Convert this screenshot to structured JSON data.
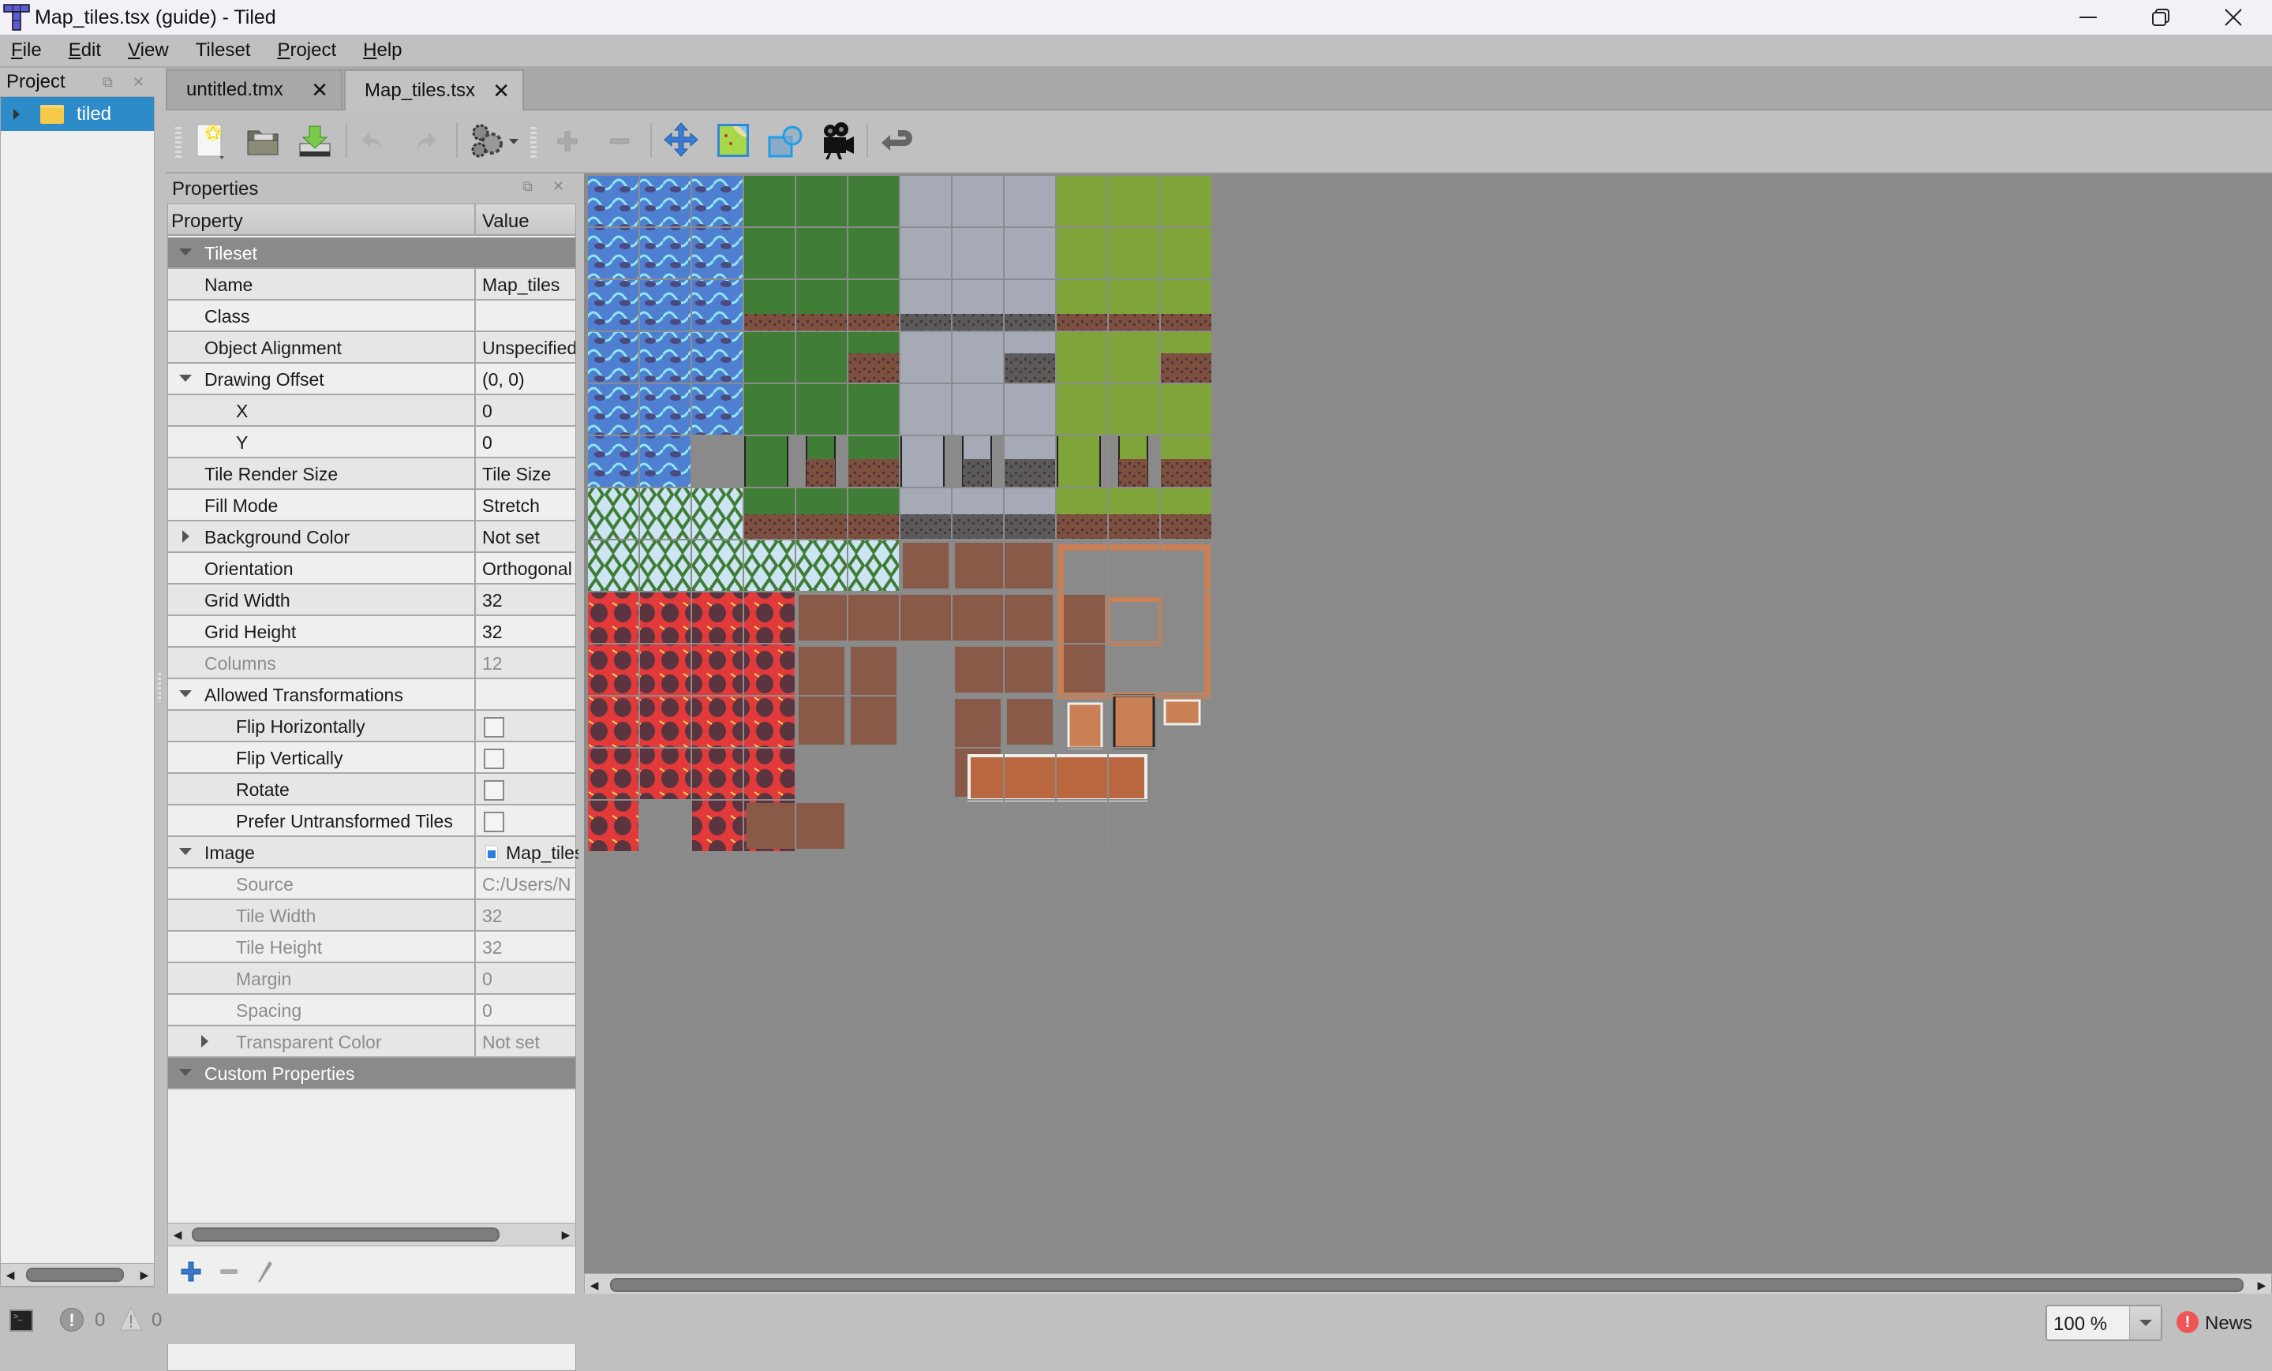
{
  "window": {
    "title": "Map_tiles.tsx (guide) - Tiled",
    "controls": [
      "minimize",
      "restore",
      "close"
    ]
  },
  "menu": [
    {
      "label": "File",
      "mnemonic": "F"
    },
    {
      "label": "Edit",
      "mnemonic": "E"
    },
    {
      "label": "View",
      "mnemonic": "V"
    },
    {
      "label": "Tileset",
      "mnemonic": ""
    },
    {
      "label": "Project",
      "mnemonic": "P"
    },
    {
      "label": "Help",
      "mnemonic": "H"
    }
  ],
  "project_panel": {
    "title": "Project",
    "tree": [
      {
        "label": "tiled",
        "icon": "folder-icon",
        "selected": true,
        "expanded": false
      }
    ]
  },
  "tabs": [
    {
      "label": "untitled.tmx",
      "active": false
    },
    {
      "label": "Map_tiles.tsx",
      "active": true
    }
  ],
  "toolbar": [
    {
      "name": "new-file",
      "enabled": true
    },
    {
      "name": "open-file",
      "enabled": true
    },
    {
      "name": "save-file",
      "enabled": true
    },
    {
      "name": "undo",
      "enabled": false
    },
    {
      "name": "redo",
      "enabled": false
    },
    {
      "name": "tileset-properties",
      "enabled": true
    },
    {
      "name": "add-tiles",
      "enabled": false
    },
    {
      "name": "remove-tiles",
      "enabled": false
    },
    {
      "name": "dynamic-wrapping",
      "enabled": true
    },
    {
      "name": "edit-terrain",
      "enabled": true
    },
    {
      "name": "edit-collision",
      "enabled": true
    },
    {
      "name": "edit-animation",
      "enabled": true
    },
    {
      "name": "back",
      "enabled": true
    }
  ],
  "properties": {
    "title": "Properties",
    "columns": [
      "Property",
      "Value"
    ],
    "rows": [
      {
        "key": "Tileset",
        "type": "group",
        "expanded": true
      },
      {
        "key": "Name",
        "value": "Map_tiles",
        "indent": 1
      },
      {
        "key": "Class",
        "value": "",
        "indent": 1
      },
      {
        "key": "Object Alignment",
        "value": "Unspecified",
        "indent": 1
      },
      {
        "key": "Drawing Offset",
        "value": "(0, 0)",
        "indent": 1,
        "expander": "down"
      },
      {
        "key": "X",
        "value": "0",
        "indent": 2
      },
      {
        "key": "Y",
        "value": "0",
        "indent": 2
      },
      {
        "key": "Tile Render Size",
        "value": "Tile Size",
        "indent": 1
      },
      {
        "key": "Fill Mode",
        "value": "Stretch",
        "indent": 1
      },
      {
        "key": "Background Color",
        "value": "Not set",
        "indent": 1,
        "expander": "right"
      },
      {
        "key": "Orientation",
        "value": "Orthogonal",
        "indent": 1
      },
      {
        "key": "Grid Width",
        "value": "32",
        "indent": 1
      },
      {
        "key": "Grid Height",
        "value": "32",
        "indent": 1
      },
      {
        "key": "Columns",
        "value": "12",
        "indent": 1,
        "disabled": true
      },
      {
        "key": "Allowed Transformations",
        "value": "",
        "indent": 1,
        "expander": "down"
      },
      {
        "key": "Flip Horizontally",
        "checkbox": false,
        "indent": 2
      },
      {
        "key": "Flip Vertically",
        "checkbox": false,
        "indent": 2
      },
      {
        "key": "Rotate",
        "checkbox": false,
        "indent": 2
      },
      {
        "key": "Prefer Untransformed Tiles",
        "checkbox": false,
        "indent": 2
      },
      {
        "key": "Image",
        "value": "Map_tiles",
        "indent": 1,
        "expander": "down",
        "icon": "image-file-icon"
      },
      {
        "key": "Source",
        "value": "C:/Users/N",
        "indent": 2,
        "disabled": true
      },
      {
        "key": "Tile Width",
        "value": "32",
        "indent": 2,
        "disabled": true
      },
      {
        "key": "Tile Height",
        "value": "32",
        "indent": 2,
        "disabled": true
      },
      {
        "key": "Margin",
        "value": "0",
        "indent": 2,
        "disabled": true
      },
      {
        "key": "Spacing",
        "value": "0",
        "indent": 2,
        "disabled": true
      },
      {
        "key": "Transparent Color",
        "value": "Not set",
        "indent": 2,
        "disabled": true,
        "expander": "right"
      },
      {
        "key": "Custom Properties",
        "type": "group",
        "expanded": true
      }
    ],
    "actions": [
      {
        "name": "add-property",
        "enabled": true
      },
      {
        "name": "remove-property",
        "enabled": false
      },
      {
        "name": "rename-property",
        "enabled": false
      }
    ]
  },
  "tileset": {
    "columns": 12,
    "rows": 13,
    "colors": {
      "water": "#4f7fd0",
      "water_light": "#8fe6f5",
      "grass_dark": "#407d36",
      "stone": "#a6a9b6",
      "grass_light": "#7ea43a",
      "dirt": "#7d4f3f",
      "vines_bg": "#cde4f2",
      "lava": "#e23a3a",
      "rock": "#5a3540",
      "path": "#8a5a48",
      "fence": "#c98055",
      "empty": "#8a8a8a",
      "grid": "#8c8c8c"
    }
  },
  "statusbar": {
    "errors": "0",
    "warnings": "0",
    "zoom": "100 %",
    "news_label": "News"
  }
}
